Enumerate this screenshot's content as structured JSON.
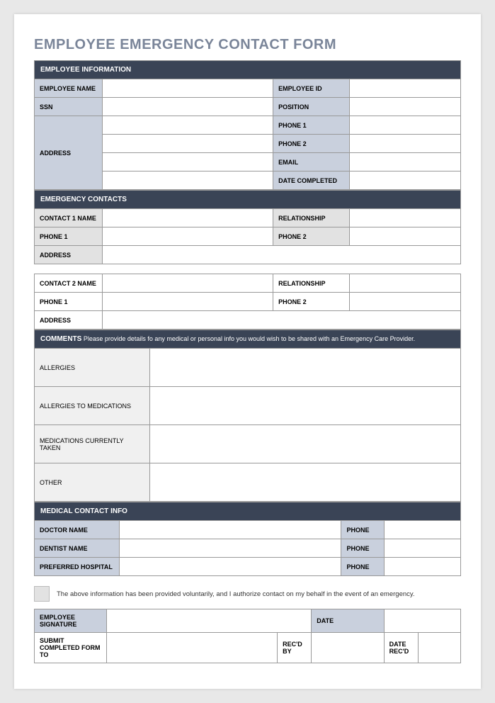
{
  "title": "EMPLOYEE EMERGENCY CONTACT FORM",
  "sections": {
    "employee_info": {
      "header": "EMPLOYEE INFORMATION",
      "labels": {
        "name": "EMPLOYEE NAME",
        "id": "EMPLOYEE ID",
        "ssn": "SSN",
        "position": "POSITION",
        "address": "ADDRESS",
        "phone1": "PHONE 1",
        "phone2": "PHONE 2",
        "email": "EMAIL",
        "date_completed": "DATE COMPLETED"
      }
    },
    "emergency": {
      "header": "EMERGENCY CONTACTS",
      "labels": {
        "contact1": "CONTACT 1 NAME",
        "relationship": "RELATIONSHIP",
        "phone1": "PHONE 1",
        "phone2": "PHONE 2",
        "address": "ADDRESS",
        "contact2": "CONTACT 2 NAME"
      }
    },
    "comments": {
      "header_bold": "COMMENTS",
      "header_rest": " Please provide details fo any medical or personal info you would wish to be shared with an Emergency Care Provider.",
      "labels": {
        "allergies": "ALLERGIES",
        "allergies_med": "ALLERGIES TO MEDICATIONS",
        "medications": "MEDICATIONS CURRENTLY TAKEN",
        "other": "OTHER"
      }
    },
    "medical": {
      "header": "MEDICAL CONTACT INFO",
      "labels": {
        "doctor": "DOCTOR NAME",
        "dentist": "DENTIST NAME",
        "hospital": "PREFERRED HOSPITAL",
        "phone": "PHONE"
      }
    },
    "auth": {
      "text": "The above information has been provided voluntarily, and I authorize contact on my behalf in the event of an emergency."
    },
    "signature": {
      "labels": {
        "sig": "EMPLOYEE SIGNATURE",
        "date": "DATE",
        "submit_to": "SUBMIT COMPLETED FORM TO",
        "recd_by": "REC'D BY",
        "date_recd": "DATE REC'D"
      }
    }
  }
}
